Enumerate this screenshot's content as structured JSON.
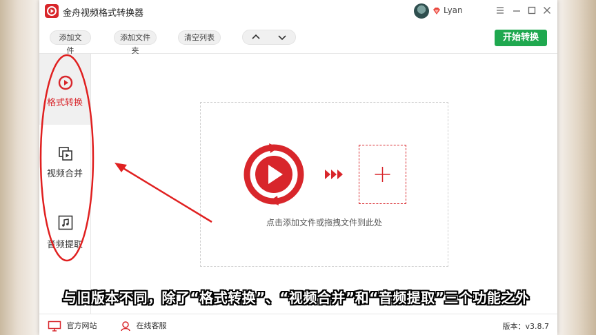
{
  "app": {
    "title": "金舟视频格式转换器",
    "username": "Lyan",
    "brand_color": "#d8262b",
    "accent_green": "#1fa84f"
  },
  "window_controls": {
    "menu_icon": "menu-icon",
    "minimize_icon": "minimize-icon",
    "maximize_icon": "maximize-icon",
    "close_icon": "close-icon"
  },
  "toolbar": {
    "add_file": "添加文件",
    "add_folder": "添加文件夹",
    "clear_list": "清空列表",
    "move_up_icon": "chevron-up-icon",
    "move_down_icon": "chevron-down-icon",
    "start_convert": "开始转换"
  },
  "sidebar": {
    "items": [
      {
        "label": "格式转换",
        "icon": "play-circle-icon",
        "active": true
      },
      {
        "label": "视频合并",
        "icon": "video-merge-icon",
        "active": false
      },
      {
        "label": "音频提取",
        "icon": "music-note-icon",
        "active": false
      }
    ]
  },
  "main": {
    "drop_hint": "点击添加文件或拖拽文件到此处",
    "add_icon": "plus-icon"
  },
  "footer": {
    "website": "官方网站",
    "support": "在线客服",
    "version": "版本：v3.8.7"
  },
  "overlay": {
    "subtitle": "与旧版本不同，除了“格式转换”、“视频合并”和“音频提取”三个功能之外"
  }
}
